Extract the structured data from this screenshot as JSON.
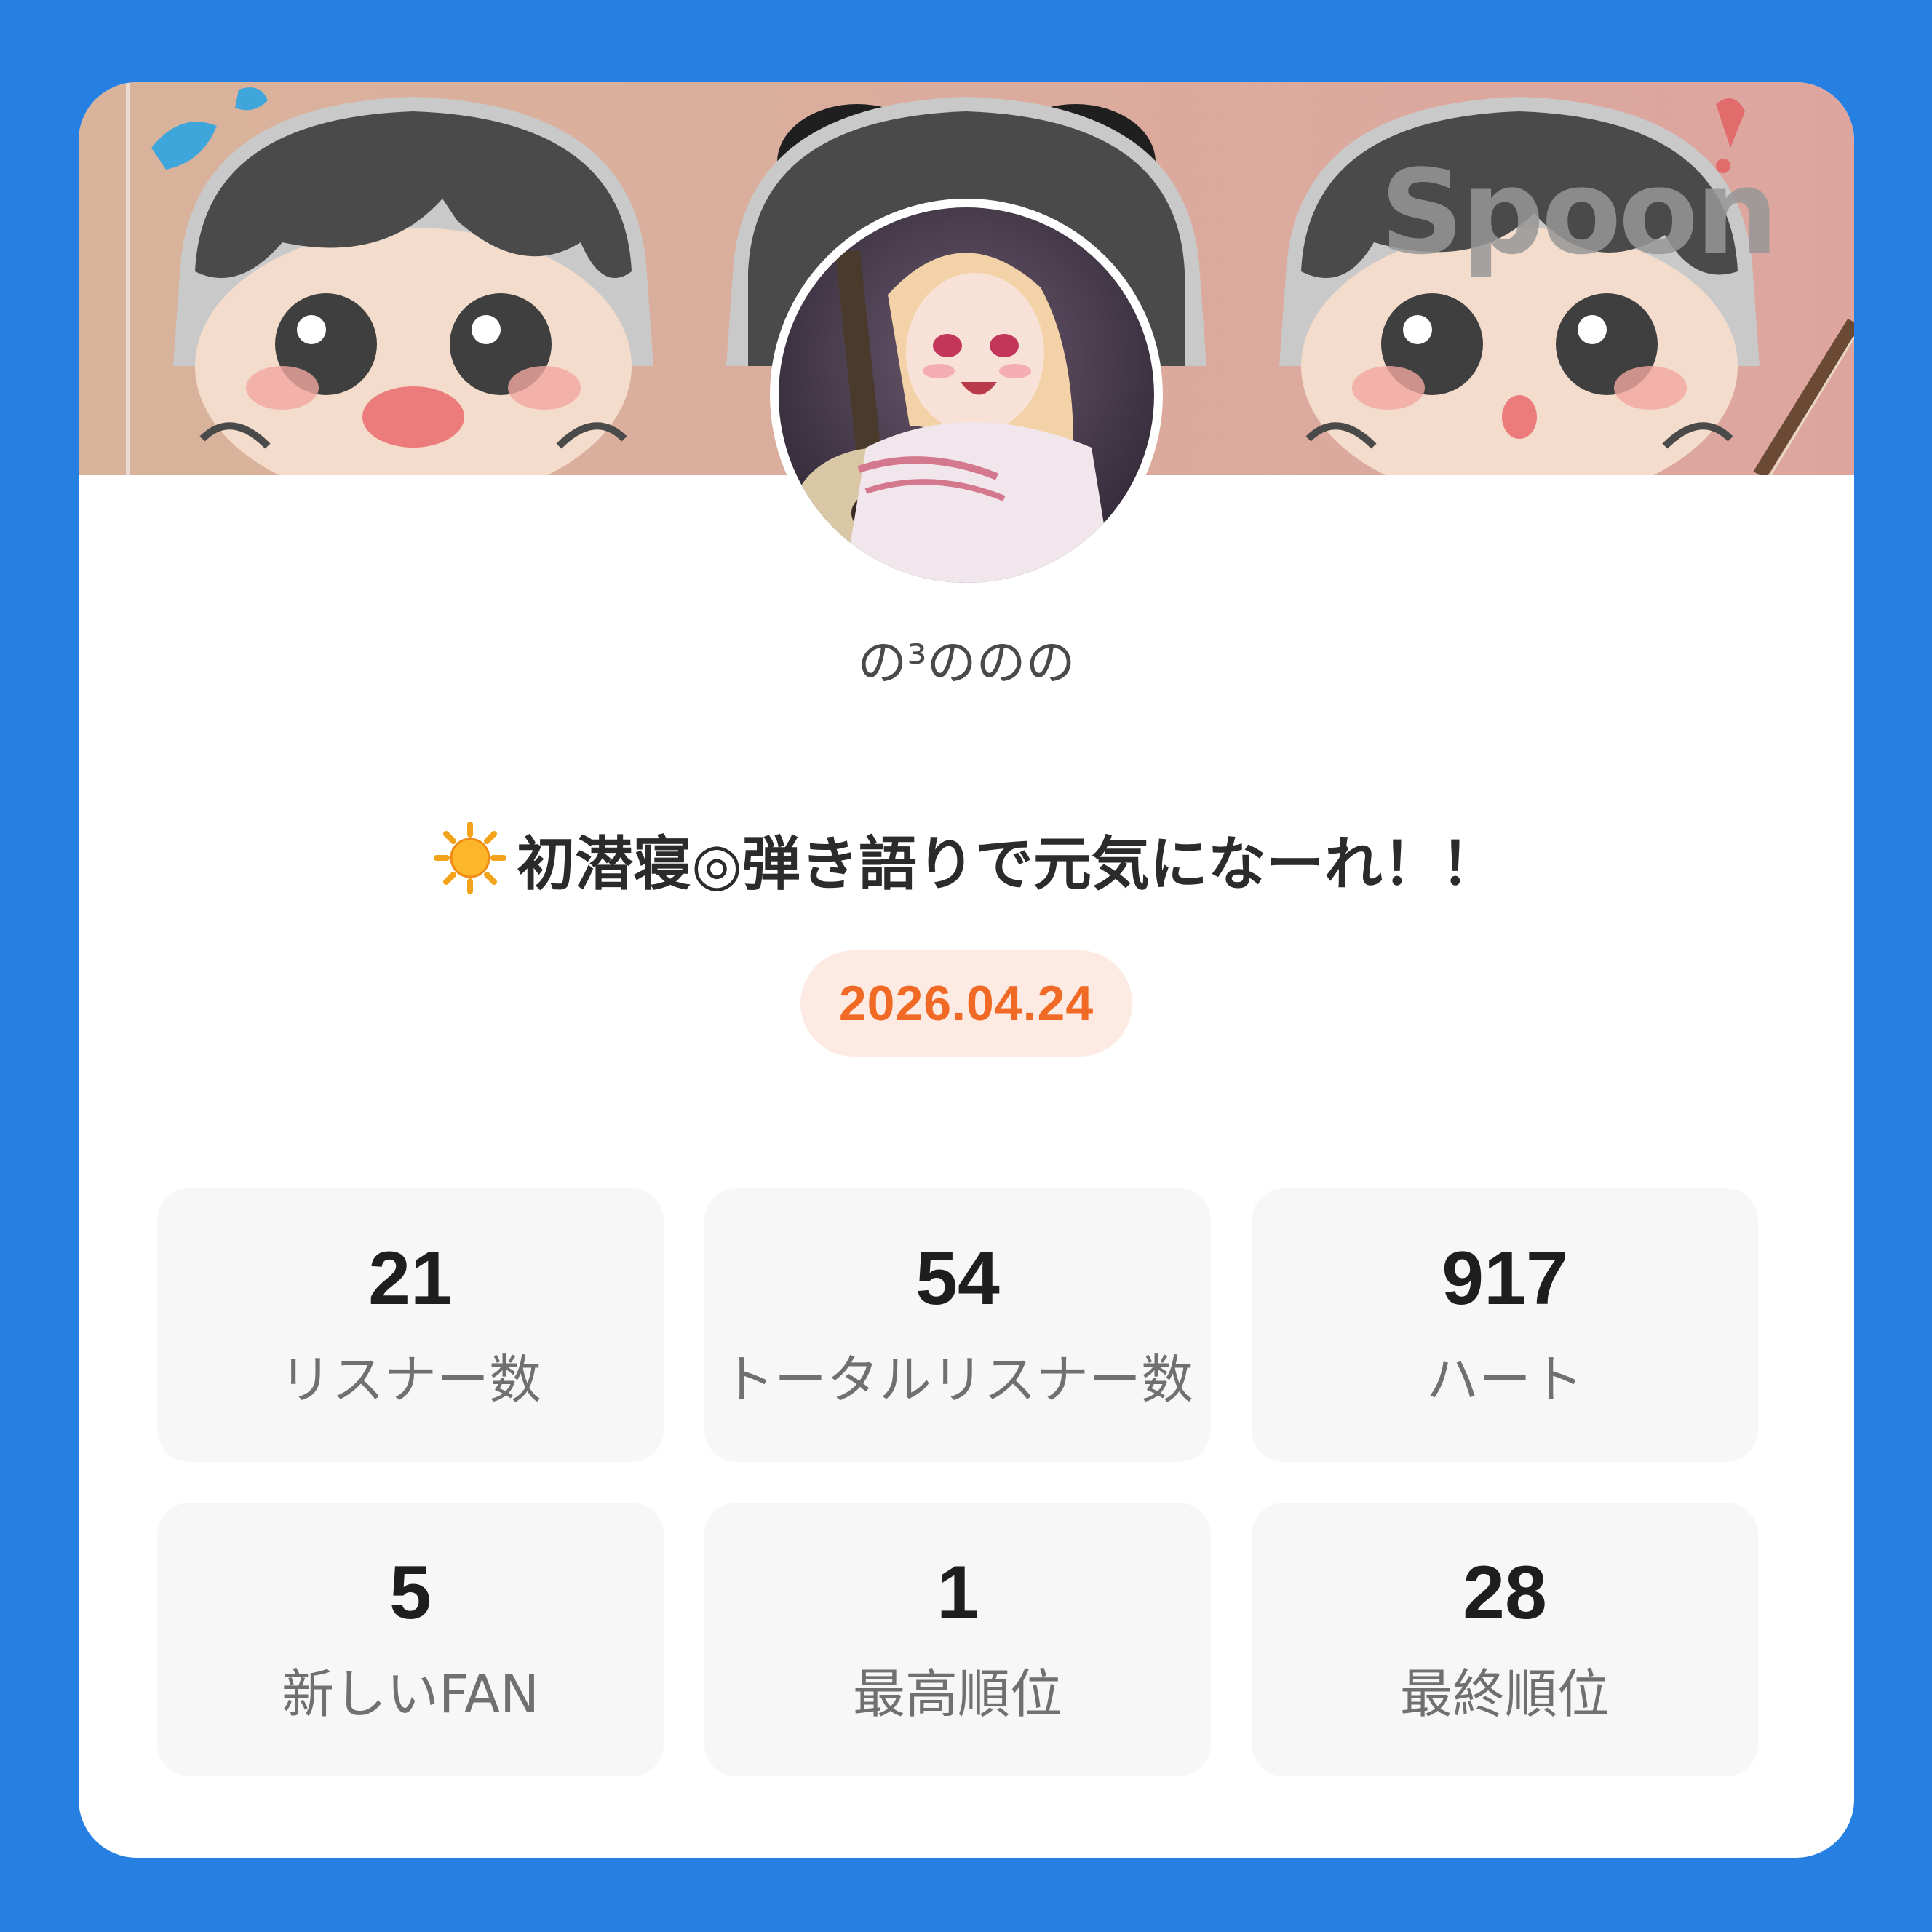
{
  "banner": {
    "logo": "Spoon"
  },
  "profile": {
    "username": "の³ののの"
  },
  "broadcast": {
    "title": "初潜寝◎弾き語りで元気になーれ！！",
    "title_icon": "sun-icon",
    "date": "2026.04.24"
  },
  "stats": [
    {
      "value": "21",
      "label": "リスナー数"
    },
    {
      "value": "54",
      "label": "トータルリスナー数"
    },
    {
      "value": "917",
      "label": "ハート"
    },
    {
      "value": "5",
      "label": "新しいFAN"
    },
    {
      "value": "1",
      "label": "最高順位"
    },
    {
      "value": "28",
      "label": "最終順位"
    }
  ],
  "colors": {
    "background": "#2680e2",
    "card": "#ffffff",
    "date_text": "#f06a25",
    "date_pill": "#fdeae3",
    "stat_box": "#f7f7f7"
  }
}
